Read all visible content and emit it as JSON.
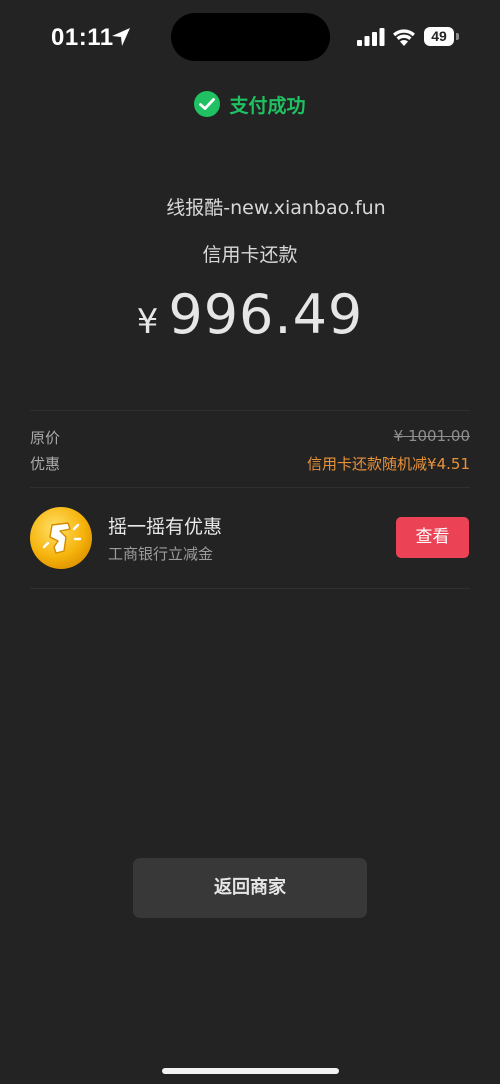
{
  "status_bar": {
    "time": "01:11",
    "battery": "49"
  },
  "header": {
    "title": "支付成功",
    "icon": "wechat-pay-icon",
    "accent_color": "#1fc162"
  },
  "payment": {
    "merchant": "线报酷-new.xianbao.fun",
    "item": "信用卡还款",
    "currency_symbol": "¥",
    "amount": "996.49"
  },
  "details": {
    "original_label": "原价",
    "original_value": "¥ 1001.00",
    "discount_label": "优惠",
    "discount_value": "信用卡还款随机减¥4.51",
    "discount_color": "#e8923a"
  },
  "promo": {
    "icon": "shake-icon",
    "title": "摇一摇有优惠",
    "subtitle": "工商银行立减金",
    "button_label": "查看",
    "button_color": "#ec4256"
  },
  "footer": {
    "back_label": "返回商家"
  }
}
